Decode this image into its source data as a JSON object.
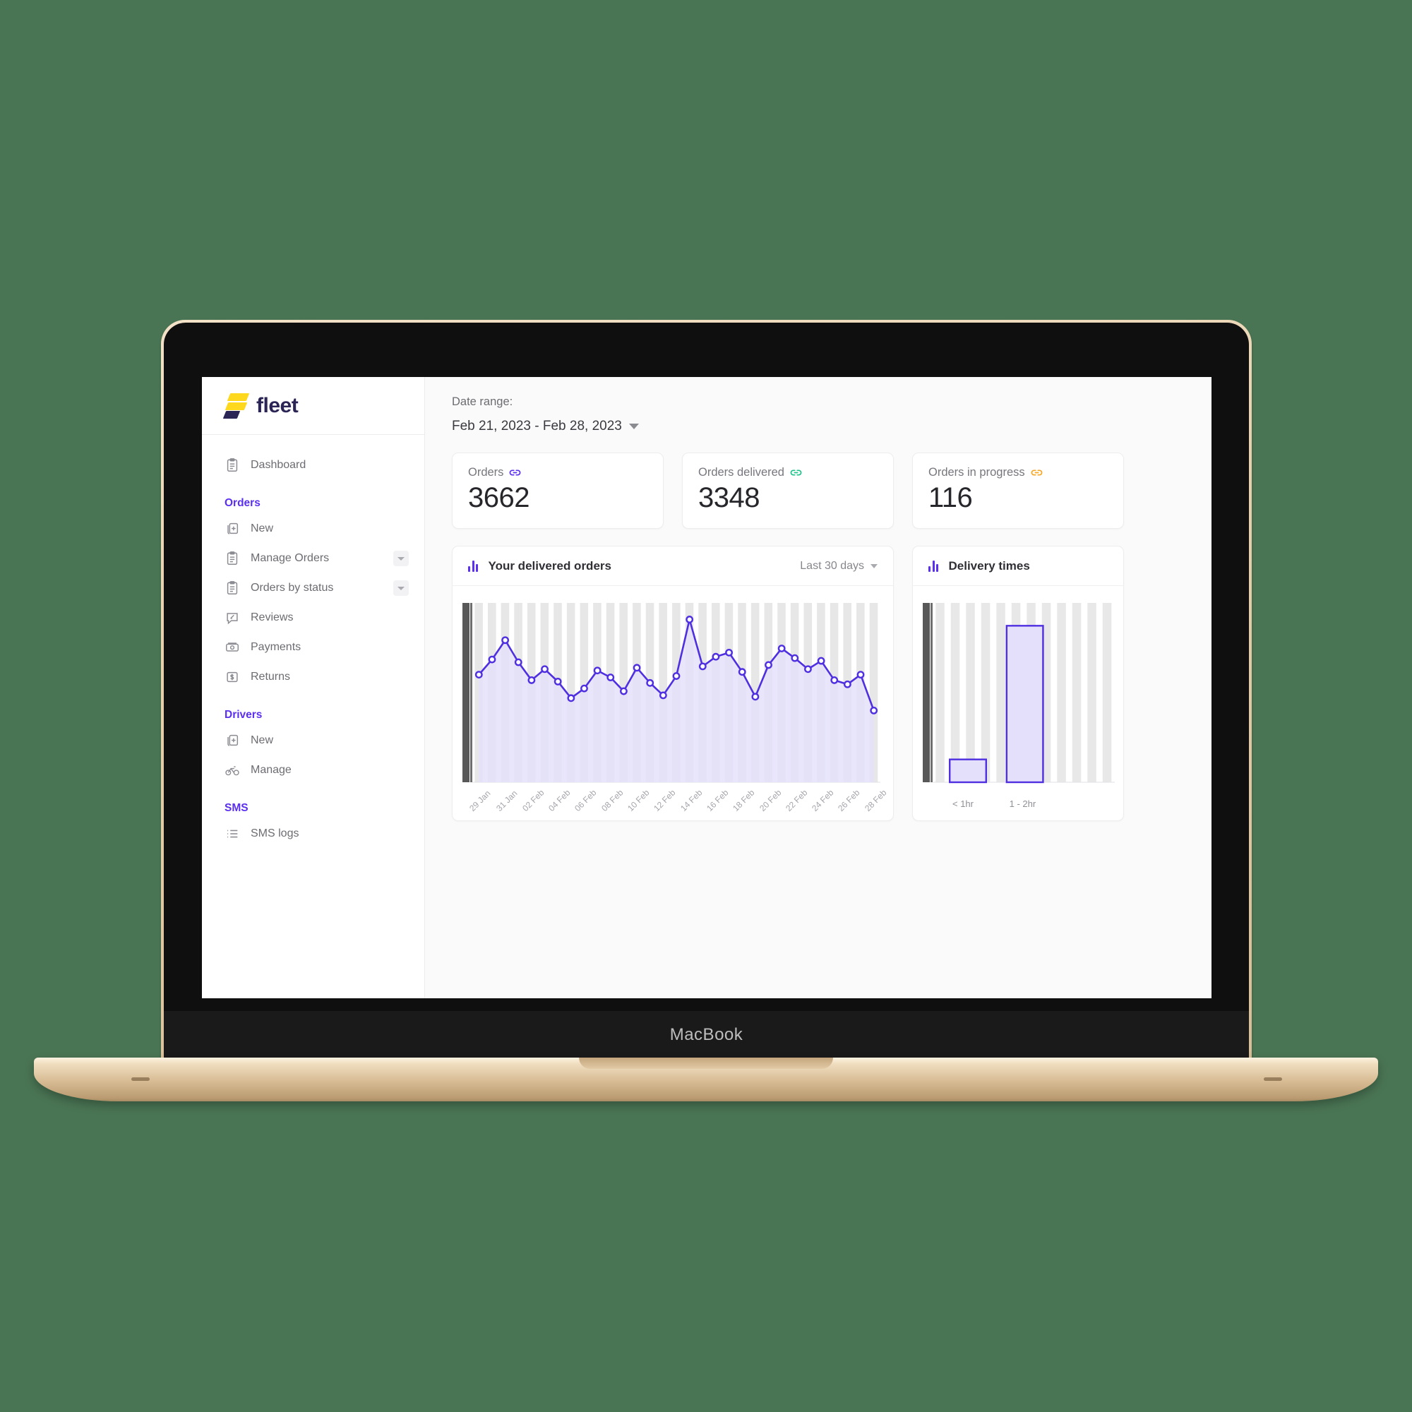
{
  "device": {
    "label": "MacBook"
  },
  "brand": {
    "name": "fleet",
    "logo_icon": "fleet-logo-mark"
  },
  "sidebar": {
    "groups": [
      {
        "title": null,
        "items": [
          {
            "label": "Dashboard",
            "icon": "clipboard-icon",
            "caret": false
          }
        ]
      },
      {
        "title": "Orders",
        "items": [
          {
            "label": "New",
            "icon": "add-document-icon",
            "caret": false
          },
          {
            "label": "Manage Orders",
            "icon": "clipboard-icon",
            "caret": true
          },
          {
            "label": "Orders by status",
            "icon": "clipboard-icon",
            "caret": true
          },
          {
            "label": "Reviews",
            "icon": "review-bubble-icon",
            "caret": false
          },
          {
            "label": "Payments",
            "icon": "banknote-icon",
            "caret": false
          },
          {
            "label": "Returns",
            "icon": "dollar-box-icon",
            "caret": false
          }
        ]
      },
      {
        "title": "Drivers",
        "items": [
          {
            "label": "New",
            "icon": "add-document-icon",
            "caret": false
          },
          {
            "label": "Manage",
            "icon": "bicycle-icon",
            "caret": false
          }
        ]
      },
      {
        "title": "SMS",
        "items": [
          {
            "label": "SMS logs",
            "icon": "list-icon",
            "caret": false
          }
        ]
      }
    ]
  },
  "main": {
    "date_range": {
      "label": "Date range:",
      "value": "Feb 21, 2023 - Feb 28, 2023",
      "caret_icon": "chevron-down-icon"
    },
    "kpis": [
      {
        "title": "Orders",
        "value": "3662",
        "icon": "link-icon",
        "icon_color": "#5b2ff0"
      },
      {
        "title": "Orders delivered",
        "value": "3348",
        "icon": "link-icon",
        "icon_color": "#1ec28b"
      },
      {
        "title": "Orders in progress",
        "value": "116",
        "icon": "link-icon",
        "icon_color": "#f5a623"
      }
    ],
    "cards": [
      {
        "title": "Your delivered orders",
        "icon": "bar-chart-icon",
        "range_label": "Last 30 days",
        "range_caret_icon": "chevron-down-icon"
      },
      {
        "title": "Delivery times",
        "icon": "bar-chart-icon"
      }
    ]
  },
  "colors": {
    "accent": "#5b2ff0",
    "line": "#4f2fe0",
    "area": "#e4e0fb",
    "stripe": "#d8d8d8",
    "brand_dark": "#2b2556",
    "brand_yellow": "#fdd81c",
    "page_bg": "#4a7554"
  },
  "chart_data": [
    {
      "type": "line",
      "title": "Your delivered orders",
      "range_label": "Last 30 days",
      "xlabel": "",
      "ylabel": "",
      "grid": false,
      "legend": "none",
      "ylim": [
        0,
        130
      ],
      "x": [
        "29 Jan",
        "30 Jan",
        "31 Jan",
        "01 Feb",
        "02 Feb",
        "03 Feb",
        "04 Feb",
        "05 Feb",
        "06 Feb",
        "07 Feb",
        "08 Feb",
        "09 Feb",
        "10 Feb",
        "11 Feb",
        "12 Feb",
        "13 Feb",
        "14 Feb",
        "15 Feb",
        "16 Feb",
        "17 Feb",
        "18 Feb",
        "19 Feb",
        "20 Feb",
        "21 Feb",
        "22 Feb",
        "23 Feb",
        "24 Feb",
        "25 Feb",
        "26 Feb",
        "27 Feb",
        "28 Feb"
      ],
      "tick_labels": [
        "29 Jan",
        "31 Jan",
        "02 Feb",
        "04 Feb",
        "06 Feb",
        "08 Feb",
        "10 Feb",
        "12 Feb",
        "14 Feb",
        "16 Feb",
        "18 Feb",
        "20 Feb",
        "22 Feb",
        "24 Feb",
        "26 Feb",
        "28 Feb"
      ],
      "values": [
        78,
        89,
        103,
        87,
        74,
        82,
        73,
        61,
        68,
        81,
        76,
        66,
        83,
        72,
        63,
        77,
        118,
        84,
        91,
        94,
        80,
        62,
        85,
        97,
        90,
        82,
        88,
        74,
        71,
        78,
        52
      ],
      "series": [
        {
          "name": "Delivered orders",
          "values": [
            78,
            89,
            103,
            87,
            74,
            82,
            73,
            61,
            68,
            81,
            76,
            66,
            83,
            72,
            63,
            77,
            118,
            84,
            91,
            94,
            80,
            62,
            85,
            97,
            90,
            82,
            88,
            74,
            71,
            78,
            52
          ]
        }
      ]
    },
    {
      "type": "bar",
      "title": "Delivery times",
      "xlabel": "",
      "ylabel": "",
      "grid": false,
      "legend": "none",
      "ylim": [
        0,
        110
      ],
      "categories": [
        "< 1hr",
        "1 - 2hr"
      ],
      "values": [
        14,
        96
      ]
    }
  ]
}
